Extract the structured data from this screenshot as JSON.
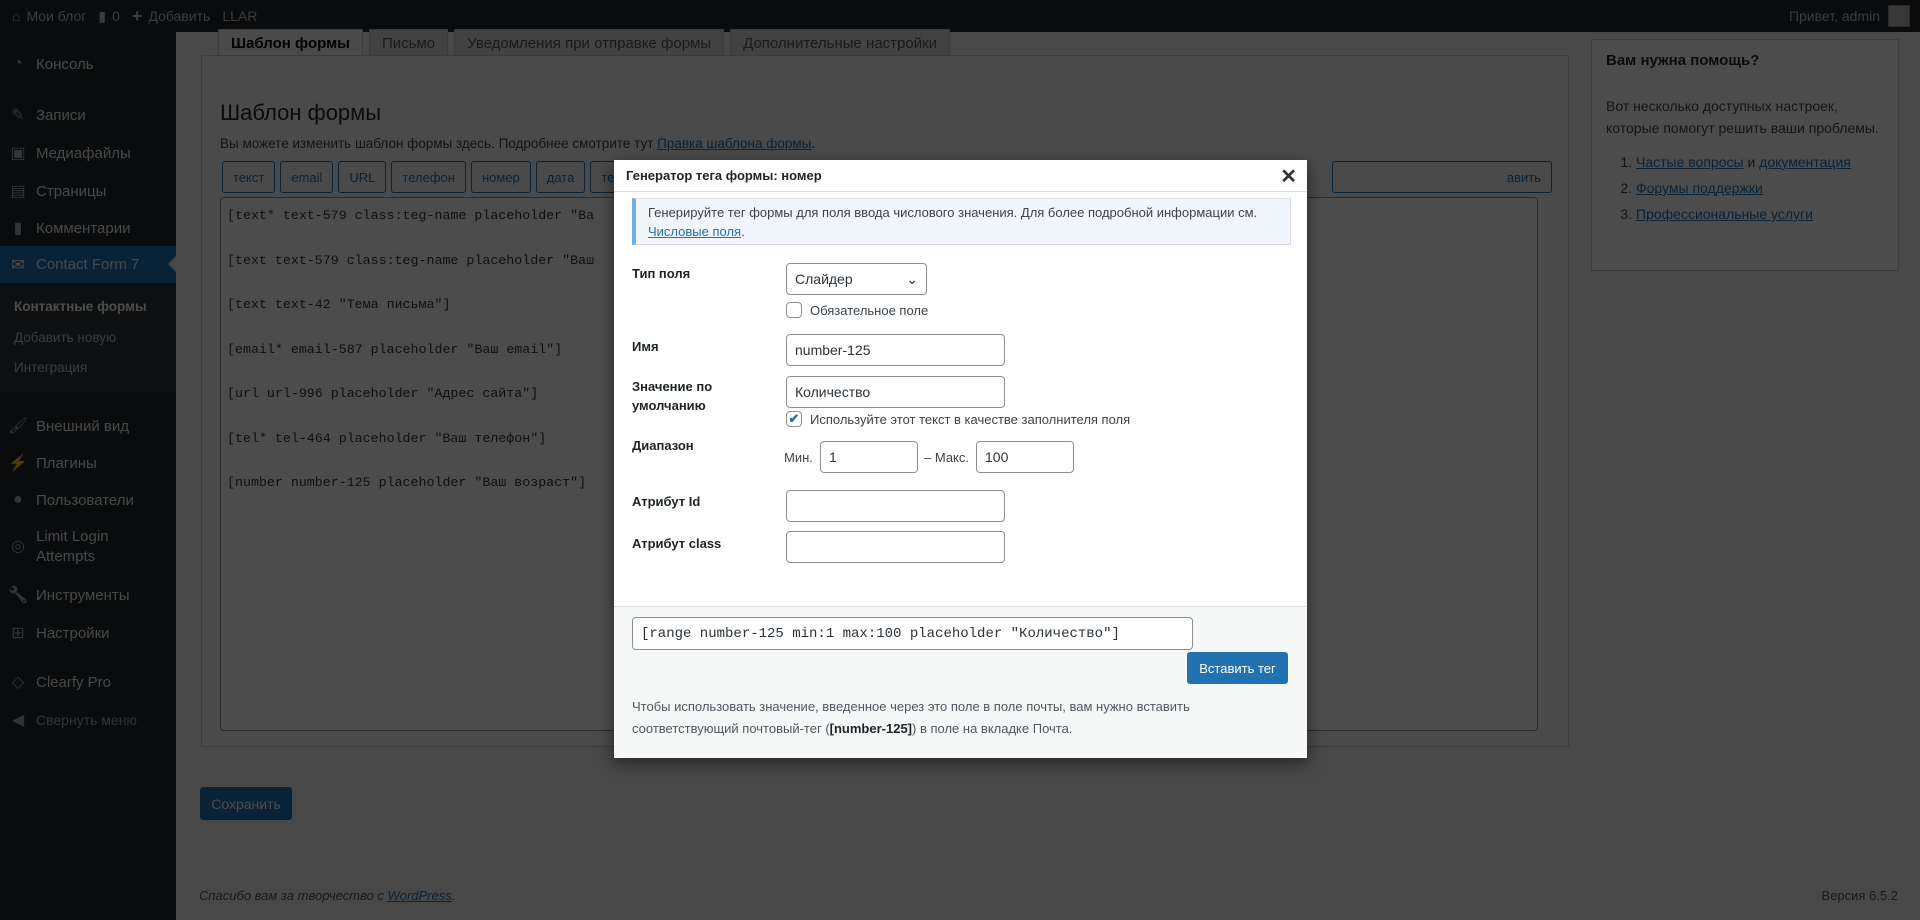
{
  "admin_bar": {
    "site": "Мои блог",
    "comments": "0",
    "add": "Добавить",
    "llar": "LLAR",
    "greeting": "Привет, admin"
  },
  "sidebar": {
    "items": [
      {
        "label": "Консоль",
        "icon": "dashboard-icon"
      },
      {
        "label": "Записи",
        "icon": "pin-icon"
      },
      {
        "label": "Медиафайлы",
        "icon": "media-icon"
      },
      {
        "label": "Страницы",
        "icon": "pages-icon"
      },
      {
        "label": "Комментарии",
        "icon": "comment-icon"
      },
      {
        "label": "Contact Form 7",
        "icon": "mail-icon",
        "active": true
      },
      {
        "label": "Внешний вид",
        "icon": "brush-icon"
      },
      {
        "label": "Плагины",
        "icon": "plugin-icon"
      },
      {
        "label": "Пользователи",
        "icon": "user-icon"
      },
      {
        "label": "Limit Login Attempts",
        "icon": "fingerprint-icon"
      },
      {
        "label": "Инструменты",
        "icon": "wrench-icon"
      },
      {
        "label": "Настройки",
        "icon": "settings-icon"
      },
      {
        "label": "Clearfy Pro",
        "icon": "diamond-icon"
      },
      {
        "label": "Свернуть меню",
        "icon": "collapse-icon"
      }
    ],
    "submenu": [
      "Контактные формы",
      "Добавить новую",
      "Интеграция"
    ]
  },
  "tabs": [
    "Шаблон формы",
    "Письмо",
    "Уведомления при отправке формы",
    "Дополнительные настройки"
  ],
  "panel": {
    "title": "Шаблон формы",
    "desc": "Вы можете изменить шаблон формы здесь. Подробнее смотрите тут ",
    "desc_link": "Правка шаблона формы",
    "tag_buttons": [
      "текст",
      "email",
      "URL",
      "телефон",
      "номер",
      "дата",
      "тексто"
    ],
    "tag_button_right": "авить",
    "template_lines": [
      "[text* text-579 class:teg-name placeholder \"Ва",
      "[text text-579 class:teg-name placeholder \"Ваш",
      "[text text-42 \"Тема письма\"]",
      "[email* email-587 placeholder \"Ваш email\"]",
      "[url url-996 placeholder \"Адрес сайта\"]",
      "[tel* tel-464 placeholder \"Ваш телефон\"]",
      "[number number-125 placeholder \"Ваш возраст\"]"
    ]
  },
  "save_label": "Сохранить",
  "footer": {
    "thanks": "Спасибо вам за творчество с ",
    "wp": "WordPress",
    "version": "Версия 6.5.2"
  },
  "help": {
    "title": "Вам нужна помощь?",
    "text": "Вот несколько доступных настроек, которые помогут решить ваши проблемы.",
    "links": {
      "faq": "Частые вопросы",
      "and": " и ",
      "docs": "документация",
      "forums": "Форумы поддержки",
      "pro": "Профессиональные услуги"
    }
  },
  "modal": {
    "title": "Генератор тега формы: номер",
    "notice": "Генерируйте тег формы для поля ввода числового значения. Для более подробной информации см. ",
    "notice_link": "Числовые поля",
    "field_type_label": "Тип поля",
    "field_type_value": "Слайдер",
    "required_label": "Обязательное поле",
    "required_checked": false,
    "name_label": "Имя",
    "name_value": "number-125",
    "default_label": "Значение по умолчанию",
    "default_value": "Количество",
    "placeholder_label": "Используйте этот текст в качестве заполнителя поля",
    "placeholder_checked": true,
    "range_label": "Диапазон",
    "min_label": "Мин.",
    "min_value": "1",
    "max_label": "– Макс.",
    "max_value": "100",
    "id_label": "Атрибут Id",
    "id_value": "",
    "class_label": "Атрибут class",
    "class_value": "",
    "generated_tag": "[range number-125 min:1 max:100 placeholder \"Количество\"]",
    "insert_label": "Вставить тег",
    "note_1": "Чтобы использовать значение, введенное через это поле в поле почты, вам нужно вставить соответствующий почтовый-тег (",
    "note_tag": "[number-125]",
    "note_2": ") в поле на вкладке Почта."
  },
  "colors": {
    "accent": "#2271b1",
    "sidebar": "#1d2327",
    "overlay": "rgba(0,0,0,0.7)"
  }
}
